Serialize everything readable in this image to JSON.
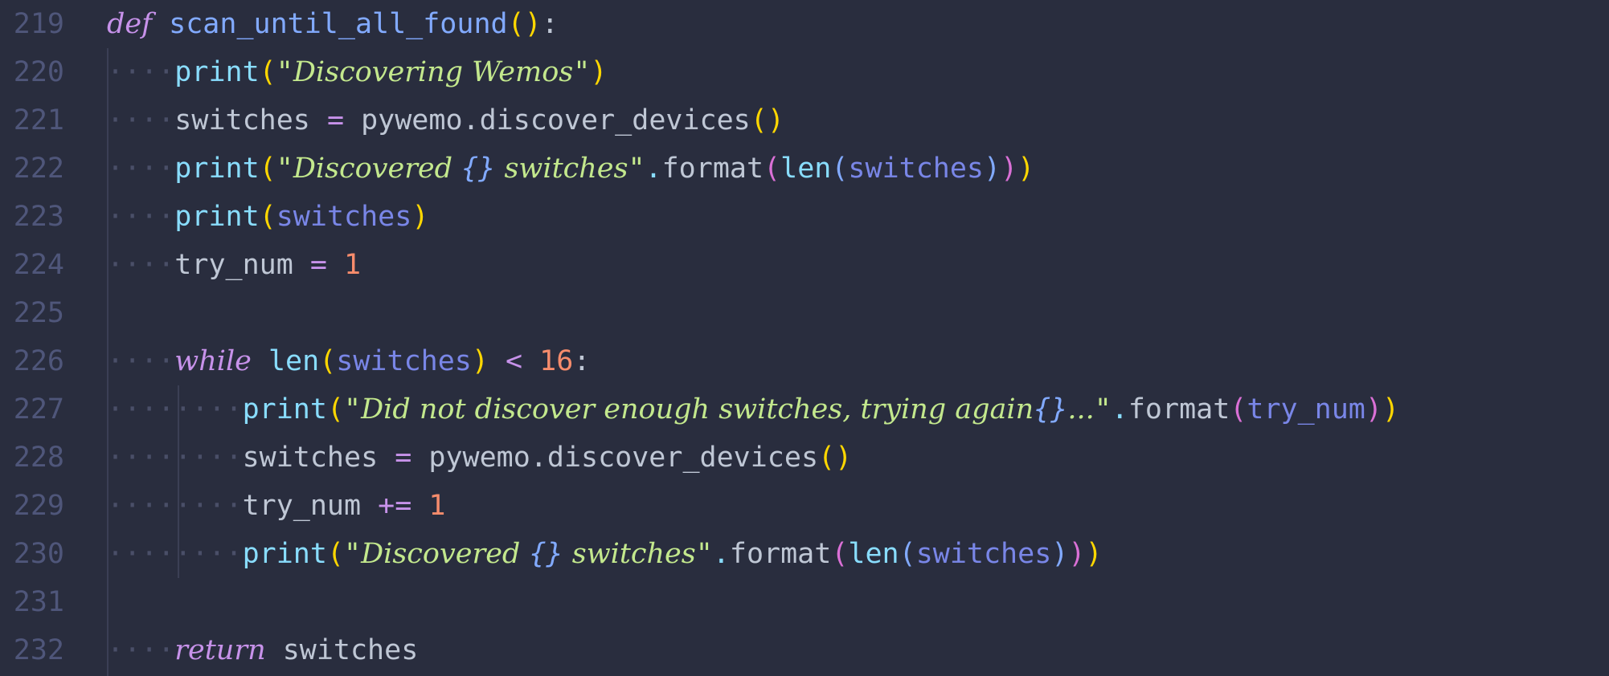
{
  "editor": {
    "lines": [
      {
        "num": "219",
        "tokens": [
          {
            "t": "def",
            "c": "kw"
          },
          {
            "t": " ",
            "c": "pl"
          },
          {
            "t": "scan_until_all_found",
            "c": "fn"
          },
          {
            "t": "(",
            "c": "br1"
          },
          {
            "t": ")",
            "c": "br1"
          },
          {
            "t": ":",
            "c": "pl"
          }
        ],
        "indent": 0
      },
      {
        "num": "220",
        "tokens": [
          {
            "t": "····",
            "c": "ws"
          },
          {
            "t": "print",
            "c": "bi"
          },
          {
            "t": "(",
            "c": "br1"
          },
          {
            "t": "\"",
            "c": "q"
          },
          {
            "t": "Discovering Wemos",
            "c": "str"
          },
          {
            "t": "\"",
            "c": "q"
          },
          {
            "t": ")",
            "c": "br1"
          }
        ],
        "indent": 1
      },
      {
        "num": "221",
        "tokens": [
          {
            "t": "····",
            "c": "ws"
          },
          {
            "t": "switches",
            "c": "pl"
          },
          {
            "t": " = ",
            "c": "op"
          },
          {
            "t": "pywemo.discover_devices",
            "c": "pl"
          },
          {
            "t": "(",
            "c": "br1"
          },
          {
            "t": ")",
            "c": "br1"
          }
        ],
        "indent": 1
      },
      {
        "num": "222",
        "tokens": [
          {
            "t": "····",
            "c": "ws"
          },
          {
            "t": "print",
            "c": "bi"
          },
          {
            "t": "(",
            "c": "br1"
          },
          {
            "t": "\"",
            "c": "q"
          },
          {
            "t": "Discovered ",
            "c": "str"
          },
          {
            "t": "{}",
            "c": "fmt"
          },
          {
            "t": " switches",
            "c": "str"
          },
          {
            "t": "\"",
            "c": "q"
          },
          {
            "t": ".",
            "c": "dot"
          },
          {
            "t": "format",
            "c": "pl"
          },
          {
            "t": "(",
            "c": "br2"
          },
          {
            "t": "len",
            "c": "bi"
          },
          {
            "t": "(",
            "c": "br3"
          },
          {
            "t": "switches",
            "c": "pr"
          },
          {
            "t": ")",
            "c": "br3"
          },
          {
            "t": ")",
            "c": "br2"
          },
          {
            "t": ")",
            "c": "br1"
          }
        ],
        "indent": 1
      },
      {
        "num": "223",
        "tokens": [
          {
            "t": "····",
            "c": "ws"
          },
          {
            "t": "print",
            "c": "bi"
          },
          {
            "t": "(",
            "c": "br1"
          },
          {
            "t": "switches",
            "c": "pr"
          },
          {
            "t": ")",
            "c": "br1"
          }
        ],
        "indent": 1
      },
      {
        "num": "224",
        "tokens": [
          {
            "t": "····",
            "c": "ws"
          },
          {
            "t": "try_num",
            "c": "pl"
          },
          {
            "t": " = ",
            "c": "op"
          },
          {
            "t": "1",
            "c": "num"
          }
        ],
        "indent": 1
      },
      {
        "num": "225",
        "tokens": [],
        "indent": 1
      },
      {
        "num": "226",
        "tokens": [
          {
            "t": "····",
            "c": "ws"
          },
          {
            "t": "while",
            "c": "kw"
          },
          {
            "t": " ",
            "c": "pl"
          },
          {
            "t": "len",
            "c": "bi"
          },
          {
            "t": "(",
            "c": "br1"
          },
          {
            "t": "switches",
            "c": "pr"
          },
          {
            "t": ")",
            "c": "br1"
          },
          {
            "t": " < ",
            "c": "op"
          },
          {
            "t": "16",
            "c": "num"
          },
          {
            "t": ":",
            "c": "pl"
          }
        ],
        "indent": 1
      },
      {
        "num": "227",
        "tokens": [
          {
            "t": "········",
            "c": "ws"
          },
          {
            "t": "print",
            "c": "bi"
          },
          {
            "t": "(",
            "c": "br1"
          },
          {
            "t": "\"",
            "c": "q"
          },
          {
            "t": "Did not discover enough switches, trying again",
            "c": "str"
          },
          {
            "t": "{}",
            "c": "fmt"
          },
          {
            "t": "...",
            "c": "str"
          },
          {
            "t": "\"",
            "c": "q"
          },
          {
            "t": ".",
            "c": "dot"
          },
          {
            "t": "format",
            "c": "pl"
          },
          {
            "t": "(",
            "c": "br2"
          },
          {
            "t": "try_num",
            "c": "pr"
          },
          {
            "t": ")",
            "c": "br2"
          },
          {
            "t": ")",
            "c": "br1"
          }
        ],
        "indent": 2
      },
      {
        "num": "228",
        "tokens": [
          {
            "t": "········",
            "c": "ws"
          },
          {
            "t": "switches",
            "c": "pl"
          },
          {
            "t": " = ",
            "c": "op"
          },
          {
            "t": "pywemo.discover_devices",
            "c": "pl"
          },
          {
            "t": "(",
            "c": "br1"
          },
          {
            "t": ")",
            "c": "br1"
          }
        ],
        "indent": 2
      },
      {
        "num": "229",
        "tokens": [
          {
            "t": "········",
            "c": "ws"
          },
          {
            "t": "try_num",
            "c": "pl"
          },
          {
            "t": " += ",
            "c": "op"
          },
          {
            "t": "1",
            "c": "num"
          }
        ],
        "indent": 2
      },
      {
        "num": "230",
        "tokens": [
          {
            "t": "········",
            "c": "ws"
          },
          {
            "t": "print",
            "c": "bi"
          },
          {
            "t": "(",
            "c": "br1"
          },
          {
            "t": "\"",
            "c": "q"
          },
          {
            "t": "Discovered ",
            "c": "str"
          },
          {
            "t": "{}",
            "c": "fmt"
          },
          {
            "t": " switches",
            "c": "str"
          },
          {
            "t": "\"",
            "c": "q"
          },
          {
            "t": ".",
            "c": "dot"
          },
          {
            "t": "format",
            "c": "pl"
          },
          {
            "t": "(",
            "c": "br2"
          },
          {
            "t": "len",
            "c": "bi"
          },
          {
            "t": "(",
            "c": "br3"
          },
          {
            "t": "switches",
            "c": "pr"
          },
          {
            "t": ")",
            "c": "br3"
          },
          {
            "t": ")",
            "c": "br2"
          },
          {
            "t": ")",
            "c": "br1"
          }
        ],
        "indent": 2
      },
      {
        "num": "231",
        "tokens": [],
        "indent": 1
      },
      {
        "num": "232",
        "tokens": [
          {
            "t": "····",
            "c": "ws"
          },
          {
            "t": "return",
            "c": "kw"
          },
          {
            "t": " switches",
            "c": "pl"
          }
        ],
        "indent": 1
      }
    ]
  }
}
